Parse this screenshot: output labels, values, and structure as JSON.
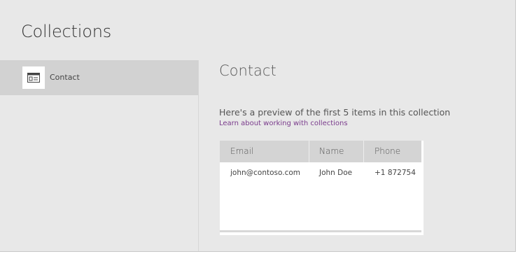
{
  "header": {
    "title": "Collections"
  },
  "sidebar": {
    "items": [
      {
        "label": "Contact",
        "icon": "contact-card-icon",
        "selected": true
      }
    ]
  },
  "main": {
    "title": "Contact",
    "preview_text": "Here's a preview of the first 5 items in this collection",
    "learn_link": "Learn about working with collections",
    "table": {
      "columns": [
        "Email",
        "Name",
        "Phone"
      ],
      "rows": [
        [
          "john@contoso.com",
          "John Doe",
          "+1 872754"
        ]
      ]
    }
  },
  "colors": {
    "background": "#e8e8e8",
    "selected_item": "#d2d2d2",
    "link": "#7a3b8c",
    "table_header": "#d4d4d4"
  }
}
